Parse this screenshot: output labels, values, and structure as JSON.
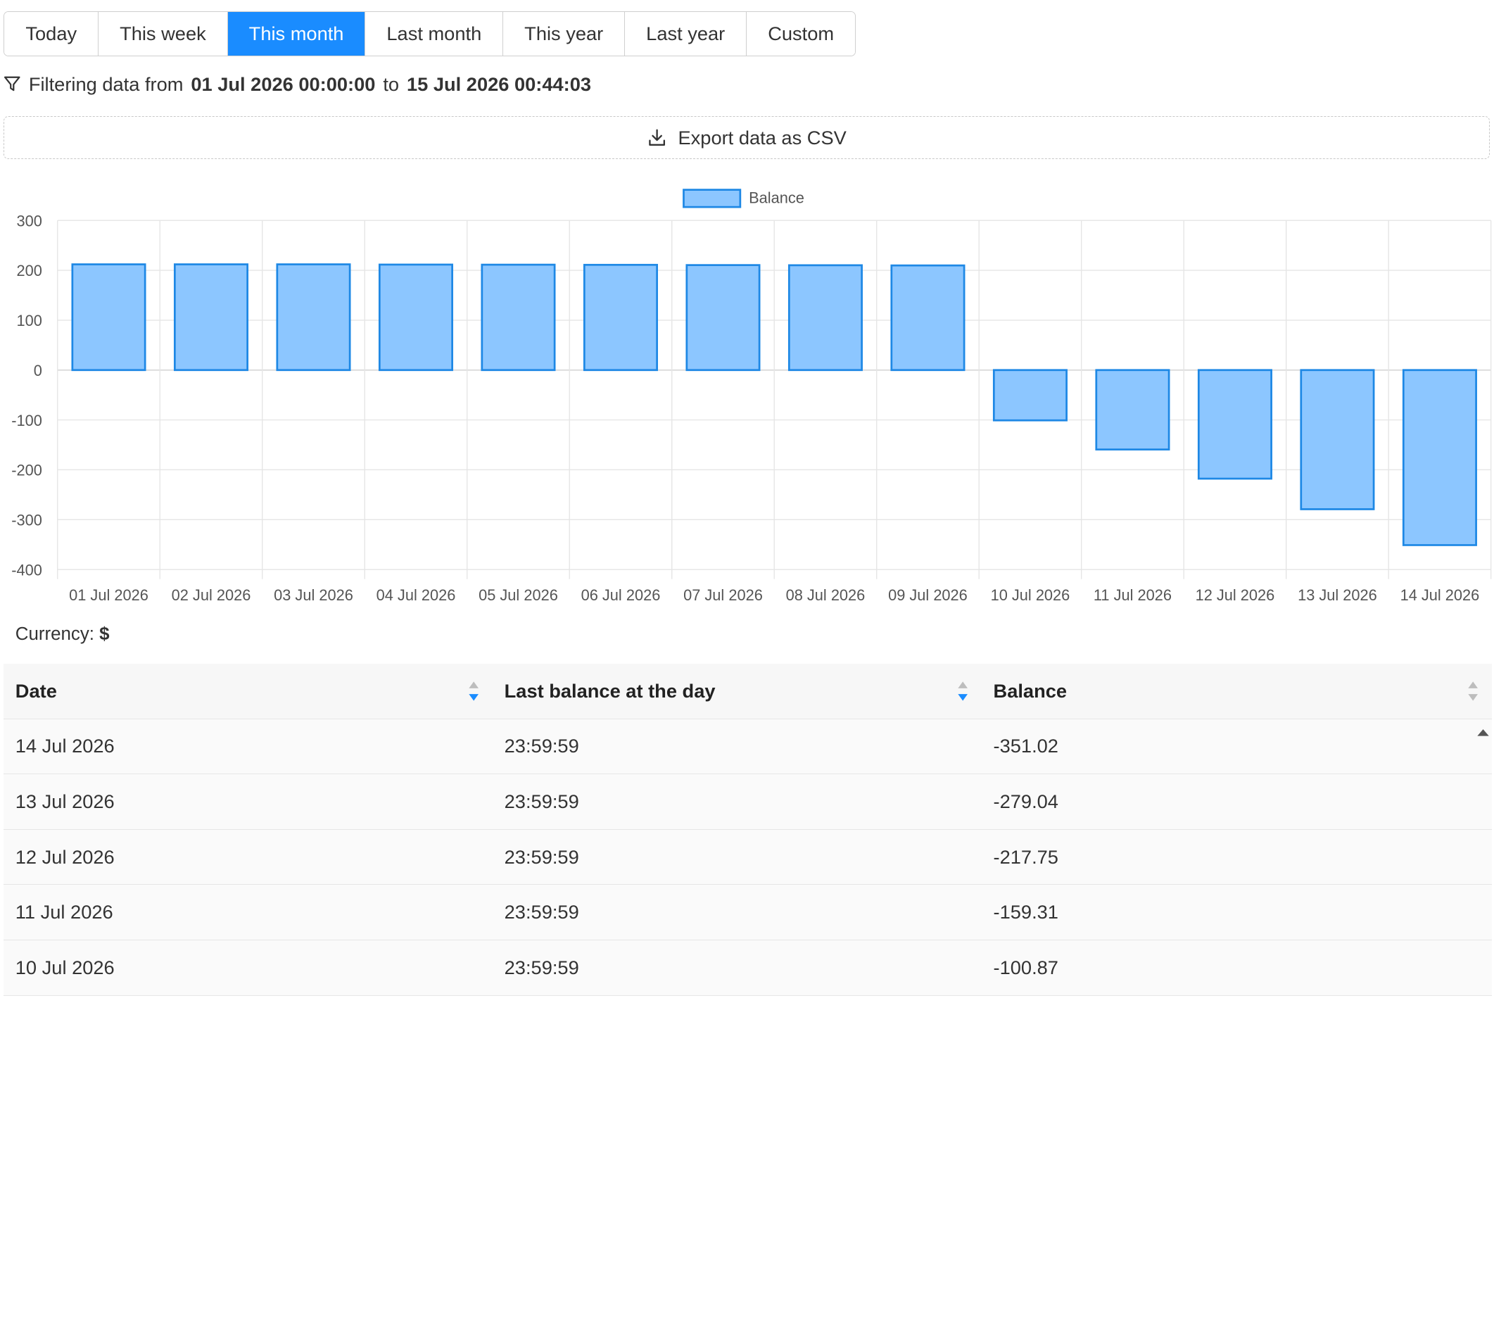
{
  "range_tabs": [
    "Today",
    "This week",
    "This month",
    "Last month",
    "This year",
    "Last year",
    "Custom"
  ],
  "active_tab_index": 2,
  "filter": {
    "prefix": "Filtering data from",
    "from": "01 Jul 2026 00:00:00",
    "joiner": "to",
    "to": "15 Jul 2026 00:44:03"
  },
  "export_label": "Export data as CSV",
  "icons": {
    "filter": "funnel-icon",
    "export": "download-icon",
    "sort": "sort-arrows-icon",
    "scroll": "scroll-up-arrow-icon"
  },
  "colors": {
    "accent": "#1a8cff",
    "bar_fill": "#8cc6ff",
    "bar_stroke": "#1e88e5",
    "sort_active": "#1a8cff",
    "sort_inactive": "#bdbdbd"
  },
  "chart_data": {
    "type": "bar",
    "legend": "Balance",
    "legend_position": "top-center",
    "grid": true,
    "categories": [
      "01 Jul 2026",
      "02 Jul 2026",
      "03 Jul 2026",
      "04 Jul 2026",
      "05 Jul 2026",
      "06 Jul 2026",
      "07 Jul 2026",
      "08 Jul 2026",
      "09 Jul 2026",
      "10 Jul 2026",
      "11 Jul 2026",
      "12 Jul 2026",
      "13 Jul 2026",
      "14 Jul 2026"
    ],
    "values": [
      212,
      212,
      212,
      211.5,
      211.3,
      211,
      210.5,
      210.2,
      209.8,
      -100.87,
      -159.31,
      -217.75,
      -279.04,
      -351.02
    ],
    "ylim": [
      -400,
      300
    ],
    "yticks": [
      300,
      200,
      100,
      0,
      -100,
      -200,
      -300,
      -400
    ],
    "title": "",
    "xlabel": "",
    "ylabel": ""
  },
  "currency": {
    "label": "Currency:",
    "symbol": "$"
  },
  "table": {
    "columns": [
      "Date",
      "Last balance at the day",
      "Balance"
    ],
    "rows": [
      [
        "14 Jul 2026",
        "23:59:59",
        "-351.02"
      ],
      [
        "13 Jul 2026",
        "23:59:59",
        "-279.04"
      ],
      [
        "12 Jul 2026",
        "23:59:59",
        "-217.75"
      ],
      [
        "11 Jul 2026",
        "23:59:59",
        "-159.31"
      ],
      [
        "10 Jul 2026",
        "23:59:59",
        "-100.87"
      ]
    ]
  }
}
